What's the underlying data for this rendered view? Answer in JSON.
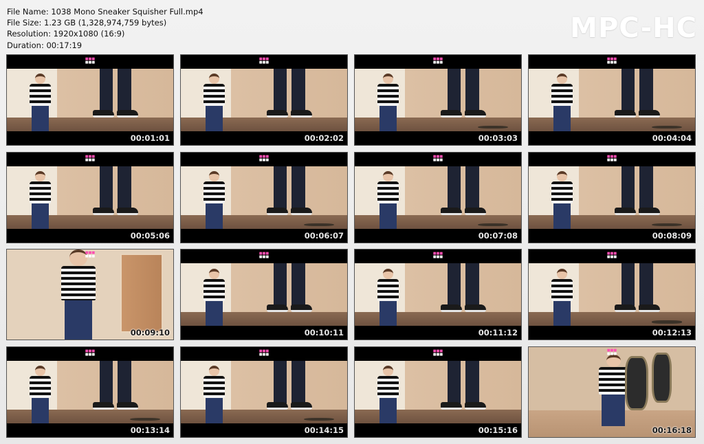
{
  "header": {
    "file_name": "File Name: 1038 Mono Sneaker Squisher Full.mp4",
    "file_size": "File Size: 1.23 GB (1,328,974,759 bytes)",
    "resolution": "Resolution: 1920x1080 (16:9)",
    "duration": "Duration: 00:17:19"
  },
  "logo": "MPC-HC",
  "thumbnails": [
    {
      "time": "00:01:01"
    },
    {
      "time": "00:02:02"
    },
    {
      "time": "00:03:03"
    },
    {
      "time": "00:04:04"
    },
    {
      "time": "00:05:06"
    },
    {
      "time": "00:06:07"
    },
    {
      "time": "00:07:08"
    },
    {
      "time": "00:08:09"
    },
    {
      "time": "00:09:10"
    },
    {
      "time": "00:10:11"
    },
    {
      "time": "00:11:12"
    },
    {
      "time": "00:12:13"
    },
    {
      "time": "00:13:14"
    },
    {
      "time": "00:14:15"
    },
    {
      "time": "00:15:16"
    },
    {
      "time": "00:16:18"
    }
  ]
}
